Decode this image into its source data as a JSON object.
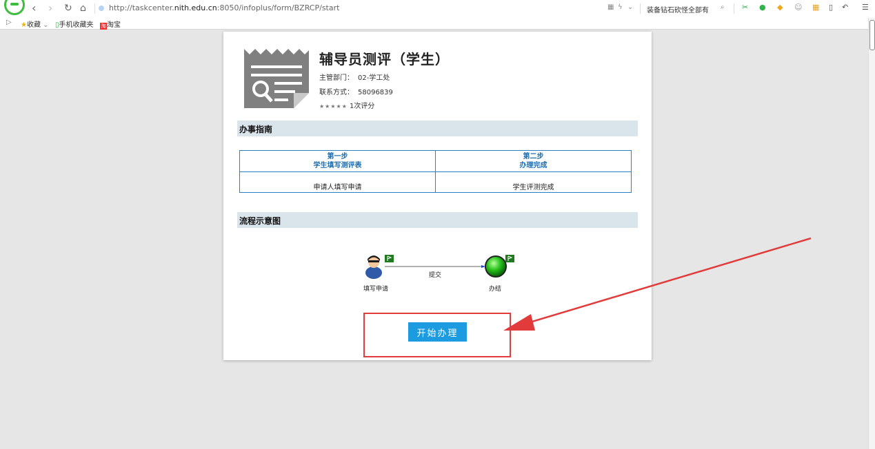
{
  "browser": {
    "url_prefix": "http://taskcenter.",
    "url_domain": "nith.edu.cn",
    "url_suffix": ":8050/infoplus/form/BZRCP/start",
    "ad_text": "装备钻石砍怪全部有",
    "bookmarks": [
      {
        "label": "收藏",
        "icon": "star-icon"
      },
      {
        "label": "手机收藏夹",
        "icon": "phone-icon"
      },
      {
        "label": "淘宝",
        "icon": "taobao-icon"
      }
    ]
  },
  "header": {
    "title": "辅导员测评（学生）",
    "dept_key": "主管部门：",
    "dept_value": "02-学工处",
    "contact_key": "联系方式：",
    "contact_value": "58096839",
    "stars": "★★★★★",
    "rating_text": "1次评分",
    "icon": "document-search-icon"
  },
  "guide": {
    "section_title": "办事指南",
    "steps": [
      {
        "step": "第一步",
        "name": "学生填写测评表",
        "desc": "申请人填写申请"
      },
      {
        "step": "第二步",
        "name": "办理完成",
        "desc": "学生评测完成"
      }
    ]
  },
  "flow": {
    "section_title": "流程示意图",
    "node_start": "填写申请",
    "edge_label": "提交",
    "node_end": "办结"
  },
  "actions": {
    "start_label": "开始办理"
  },
  "colors": {
    "accent": "#1c9be0",
    "section_bg": "#dae4eb",
    "table_border": "#2a7fc3",
    "annotation": "#e23b3b"
  }
}
